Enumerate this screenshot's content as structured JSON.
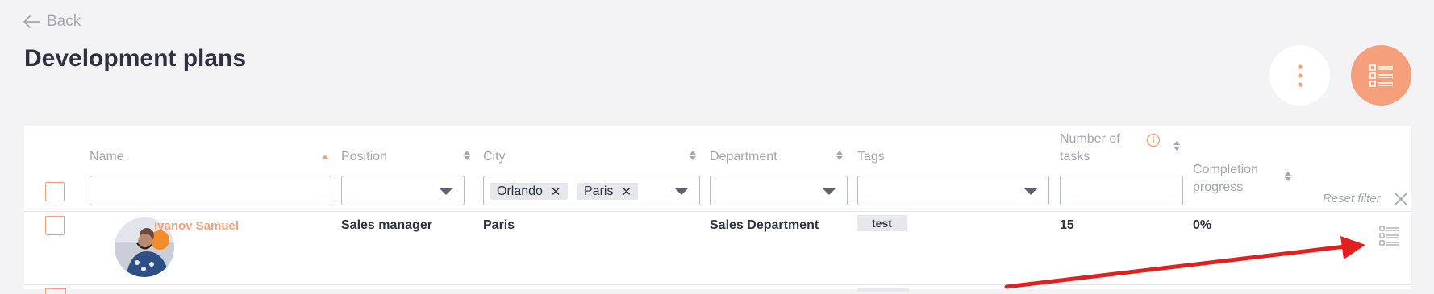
{
  "nav": {
    "back_label": "Back"
  },
  "page": {
    "title": "Development plans"
  },
  "table": {
    "columns": {
      "name": "Name",
      "position": "Position",
      "city": "City",
      "department": "Department",
      "tags": "Tags",
      "tasks_line1": "Number of",
      "tasks_line2": "tasks",
      "progress_line1": "Completion",
      "progress_line2": "progress"
    },
    "filters": {
      "city_chips": [
        "Orlando",
        "Paris"
      ]
    },
    "reset_filter": "Reset filter",
    "rows": [
      {
        "name": "Ivanov Samuel",
        "position": "Sales manager",
        "city": "Paris",
        "department": "Sales Department",
        "tag": "test",
        "tasks": "15",
        "progress": "0%"
      }
    ]
  },
  "colors": {
    "accent": "#f6a07b",
    "annotation_arrow": "#e41f1f"
  }
}
